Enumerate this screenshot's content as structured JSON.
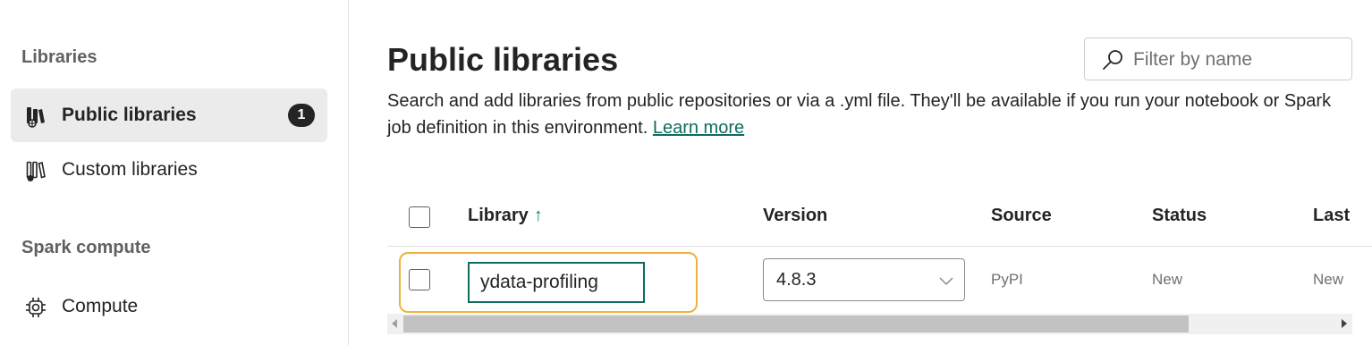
{
  "sidebar": {
    "section_libraries": "Libraries",
    "items": [
      {
        "label": "Public libraries",
        "icon": "public-libraries-icon",
        "badge": "1",
        "selected": true
      },
      {
        "label": "Custom libraries",
        "icon": "custom-libraries-icon",
        "selected": false
      }
    ],
    "section_spark": "Spark compute",
    "compute_item": {
      "label": "Compute",
      "icon": "gear-icon"
    }
  },
  "main": {
    "title": "Public libraries",
    "filter": {
      "placeholder": "Filter by name",
      "icon": "search-icon"
    },
    "description": "Search and add libraries from public repositories or via a .yml file. They'll be available if you run your notebook or Spark job definition in this environment.",
    "learn_more": "Learn more"
  },
  "table": {
    "columns": {
      "library": "Library",
      "sort_indicator": "↑",
      "version": "Version",
      "source": "Source",
      "status": "Status",
      "last": "Last"
    },
    "rows": [
      {
        "library": "ydata-profiling",
        "version": "4.8.3",
        "source": "PyPI",
        "status": "New",
        "last": "New"
      }
    ]
  },
  "colors": {
    "accent": "#0f6c5e",
    "highlight": "#f0b23a",
    "selected_bg": "#ebebeb"
  }
}
